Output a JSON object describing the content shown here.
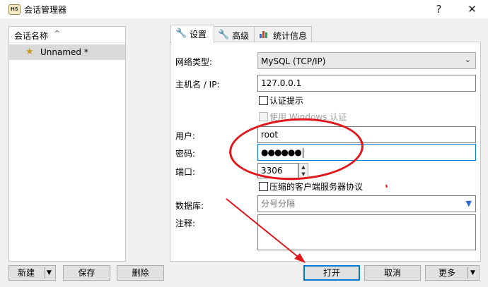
{
  "window": {
    "icon_text": "HS",
    "title": "会话管理器",
    "help_glyph": "?",
    "close_glyph": "✕"
  },
  "sidebar": {
    "column_header": "会话名称",
    "sort_glyph": "^",
    "items": [
      {
        "icon": "star-icon",
        "label": "Unnamed *",
        "selected": true
      }
    ]
  },
  "tabs": [
    {
      "icon": "wrench-icon",
      "label": "设置",
      "active": true
    },
    {
      "icon": "wrench-icon",
      "label": "高级",
      "active": false
    },
    {
      "icon": "bar-chart-icon",
      "label": "统计信息",
      "active": false
    }
  ],
  "settings": {
    "network_type_label": "网络类型:",
    "network_type_value": "MySQL (TCP/IP)",
    "host_label": "主机名 / IP:",
    "host_value": "127.0.0.1",
    "auth_prompt_label": "认证提示",
    "windows_auth_label": "使用 Windows 认证",
    "user_label": "用户:",
    "user_value": "root",
    "password_label": "密码:",
    "password_value": "●●●●●●",
    "port_label": "端口:",
    "port_value": "3306",
    "compressed_protocol_label": "压缩的客户端服务器协议",
    "database_label": "数据库:",
    "database_placeholder": "分号分隔",
    "comment_label": "注释:",
    "comment_value": ""
  },
  "buttons": {
    "new": "新建",
    "save": "保存",
    "delete": "删除",
    "open": "打开",
    "cancel": "取消",
    "more": "更多"
  },
  "colors": {
    "annotation": "#e2151b",
    "selected_row": "#d9d9d9",
    "focus_border": "#0078d7"
  }
}
